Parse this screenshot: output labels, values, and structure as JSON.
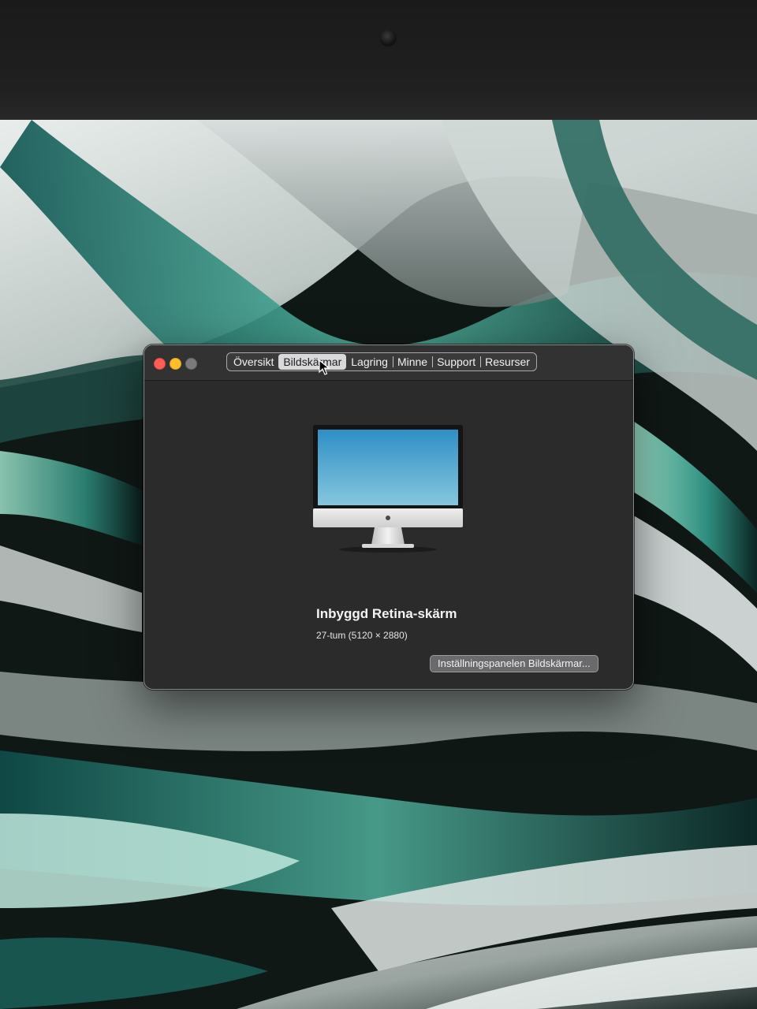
{
  "window": {
    "tabs": [
      {
        "label": "Översikt",
        "active": false
      },
      {
        "label": "Bildskärmar",
        "active": true
      },
      {
        "label": "Lagring",
        "active": false
      },
      {
        "label": "Minne",
        "active": false
      },
      {
        "label": "Support",
        "active": false
      },
      {
        "label": "Resurser",
        "active": false
      }
    ],
    "traffic_lights": {
      "close_color": "#ff5f57",
      "minimize_color": "#febc2e",
      "zoom_color": "#7b7b7d"
    }
  },
  "display": {
    "icon": "imac-icon",
    "name": "Inbyggd Retina-skärm",
    "spec": "27-tum (5120 × 2880)"
  },
  "buttons": {
    "display_prefs_label": "Inställningspanelen Bildskärmar..."
  }
}
